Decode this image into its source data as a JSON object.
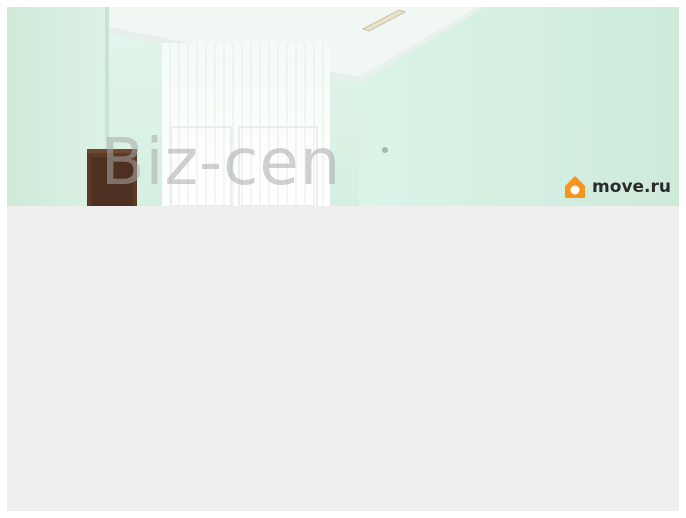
{
  "photo": {
    "watermark_text": "Biz-cen",
    "brand": {
      "text": "move.ru",
      "color": "#f7941d"
    },
    "wall_color": "#d7f0e2"
  },
  "background": "#efefef"
}
